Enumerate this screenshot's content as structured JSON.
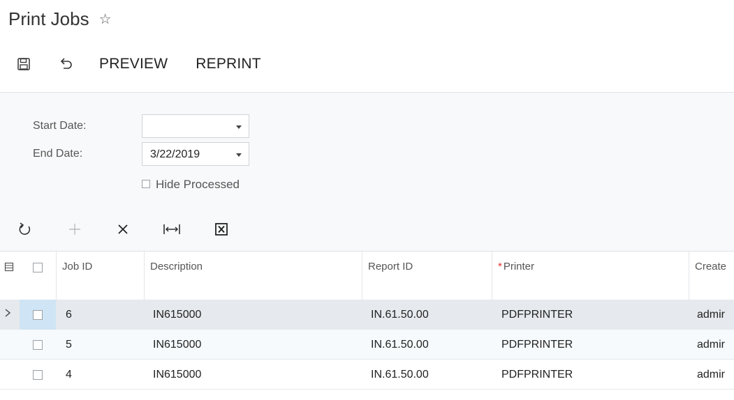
{
  "page": {
    "title": "Print Jobs"
  },
  "toolbar": {
    "preview_label": "PREVIEW",
    "reprint_label": "REPRINT"
  },
  "filters": {
    "start_date_label": "Start Date:",
    "start_date_value": "",
    "end_date_label": "End Date:",
    "end_date_value": "3/22/2019",
    "hide_processed_label": "Hide Processed",
    "hide_processed_checked": false
  },
  "grid": {
    "columns": {
      "job_id": "Job ID",
      "description": "Description",
      "report_id": "Report ID",
      "printer": "Printer",
      "created_by": "Create"
    },
    "required_marker": "*",
    "rows": [
      {
        "job_id": "6",
        "description": "IN615000",
        "report_id": "IN.61.50.00",
        "printer": "PDFPRINTER",
        "created_by": "admir"
      },
      {
        "job_id": "5",
        "description": "IN615000",
        "report_id": "IN.61.50.00",
        "printer": "PDFPRINTER",
        "created_by": "admir"
      },
      {
        "job_id": "4",
        "description": "IN615000",
        "report_id": "IN.61.50.00",
        "printer": "PDFPRINTER",
        "created_by": "admir"
      }
    ]
  },
  "colors": {
    "accent_required": "#e0322e",
    "selected_row": "#e6e9ed",
    "selected_cell": "#cfe4f4"
  }
}
